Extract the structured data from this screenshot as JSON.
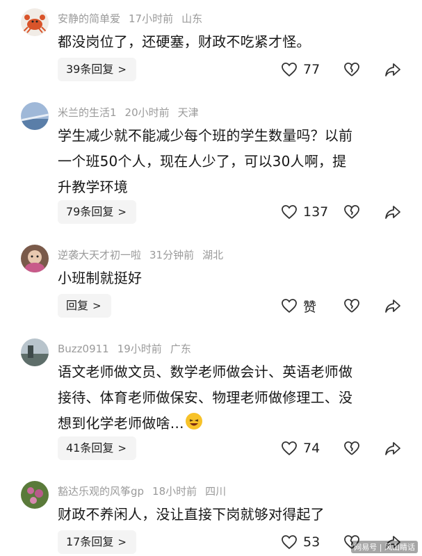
{
  "comments": [
    {
      "username": "安静的简单爱",
      "time": "17小时前",
      "location": "山东",
      "lines": [
        "都没岗位了，还硬塞，财政不吃紧才怪。"
      ],
      "reply_label": "39条回复",
      "like_count": "77",
      "avatar": "crab-avatar"
    },
    {
      "username": "米兰的生活1",
      "time": "20小时前",
      "location": "天津",
      "lines": [
        "学生减少就不能减少每个班的学生数量吗？以前",
        "一个班50个人，现在人少了，可以30人啊，提",
        "升教学环境"
      ],
      "reply_label": "79条回复",
      "like_count": "137",
      "avatar": "sky-avatar"
    },
    {
      "username": "逆袭大天才初一啦",
      "time": "31分钟前",
      "location": "湖北",
      "lines": [
        "小班制就挺好"
      ],
      "reply_label": "回复",
      "like_count": "赞",
      "avatar": "doll-avatar"
    },
    {
      "username": "Buzz0911",
      "time": "19小时前",
      "location": "广东",
      "lines": [
        "语文老师做文员、数学老师做会计、英语老师做",
        "接待、体育老师做保安、物理老师做修理工、没",
        "想到化学老师做啥…"
      ],
      "reply_label": "41条回复",
      "like_count": "74",
      "avatar": "landscape-avatar"
    },
    {
      "username": "豁达乐观的风筝gp",
      "time": "18小时前",
      "location": "四川",
      "lines": [
        "财政不养闲人，没让直接下岗就够对得起了"
      ],
      "reply_label": "17条回复",
      "like_count": "53",
      "avatar": "flower-avatar"
    }
  ],
  "watermark": "网易号 | 风山睛话"
}
